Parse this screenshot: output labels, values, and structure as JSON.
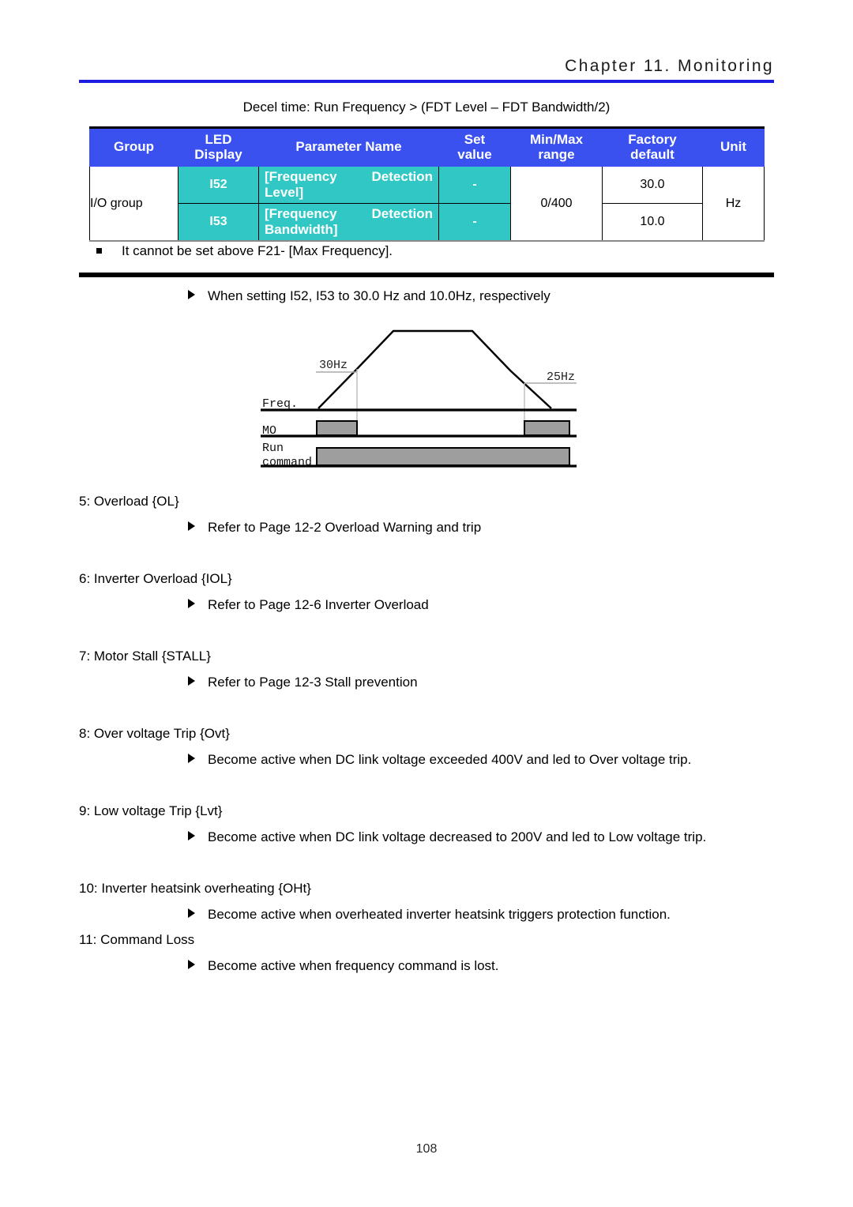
{
  "header": {
    "chapter_title": "Chapter 11. Monitoring",
    "rule_color": "#1c1ce0"
  },
  "table_caption": "Decel time: Run Frequency > (FDT Level – FDT Bandwidth/2)",
  "param_table": {
    "header_bg": "#3a50ef",
    "cell_bg": "#31c7c4",
    "columns": [
      "Group",
      "LED Display",
      "Parameter Name",
      "Set value",
      "Min/Max range",
      "Factory default",
      "Unit"
    ],
    "columns_split": [
      {
        "l1": "Group",
        "l2": ""
      },
      {
        "l1": "LED",
        "l2": "Display"
      },
      {
        "l1": "Parameter Name",
        "l2": ""
      },
      {
        "l1": "Set",
        "l2": "value"
      },
      {
        "l1": "Min/Max",
        "l2": "range"
      },
      {
        "l1": "Factory",
        "l2": "default"
      },
      {
        "l1": "Unit",
        "l2": ""
      }
    ],
    "group_label": "I/O group",
    "minmax_range": "0/400",
    "unit": "Hz",
    "rows": [
      {
        "led": "I52",
        "param_l1_a": "[Frequency",
        "param_l1_b": "Detection",
        "param_l2": "Level]",
        "set_value": "-",
        "factory_default": "30.0"
      },
      {
        "led": "I53",
        "param_l1_a": "[Frequency",
        "param_l1_b": "Detection",
        "param_l2": "Bandwidth]",
        "set_value": "-",
        "factory_default": "10.0"
      }
    ]
  },
  "note_square": "It cannot be set above F21- [Max Frequency].",
  "diagram_intro": "When setting I52, I53 to 30.0 Hz and 10.0Hz, respectively",
  "timing_diagram": {
    "label_freq": "Freq.",
    "label_mo": "MO",
    "label_run_l1": "Run",
    "label_run_l2": "command",
    "label_left_level": "30Hz",
    "label_right_level": "25Hz",
    "fill_color": "#9e9e9e"
  },
  "sections": [
    {
      "heading": "5: Overload {OL}",
      "bullet": "Refer to Page 12-2 Overload Warning and trip"
    },
    {
      "heading": "6: Inverter Overload {IOL}",
      "bullet": "Refer to Page 12-6 Inverter Overload"
    },
    {
      "heading": "7: Motor Stall {STALL}",
      "bullet": "Refer to Page 12-3 Stall prevention"
    },
    {
      "heading": "8: Over voltage Trip {Ovt}",
      "bullet": "Become active when DC link voltage exceeded 400V and led to Over voltage trip."
    },
    {
      "heading": "9: Low voltage Trip {Lvt}",
      "bullet": "Become active when DC link voltage decreased to 200V and led to Low voltage trip."
    },
    {
      "heading": "10: Inverter heatsink overheating {OHt}",
      "bullet": "Become active when overheated inverter heatsink triggers protection function."
    },
    {
      "heading": "11: Command Loss",
      "bullet": "Become active when frequency command is lost."
    }
  ],
  "page_number": "108"
}
